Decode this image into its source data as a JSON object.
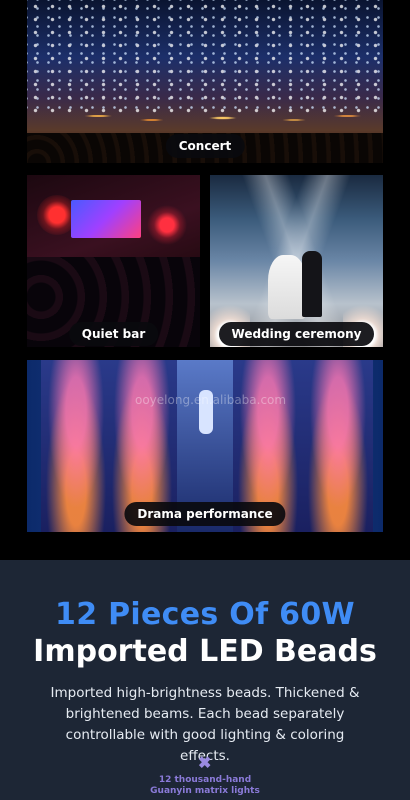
{
  "panels": {
    "concert": "Concert",
    "quiet_bar": "Quiet bar",
    "wedding": "Wedding ceremony",
    "drama": "Drama performance"
  },
  "watermark": "ooyelong.en.alibaba.com",
  "info": {
    "title_line1": "12 Pieces Of 60W",
    "title_line2": "Imported LED Beads",
    "description": "Imported high-brightness beads. Thickened & brightened beams. Each bead separately controllable with good lighting & coloring effects.",
    "icon_glyph": "✖",
    "bottom_caption_line1": "12 thousand-hand",
    "bottom_caption_line2": "Guanyin matrix lights"
  },
  "colors": {
    "accent_blue": "#3f8cf5",
    "panel_bg": "#1d2635",
    "caption_purple": "#8a7ad8"
  }
}
